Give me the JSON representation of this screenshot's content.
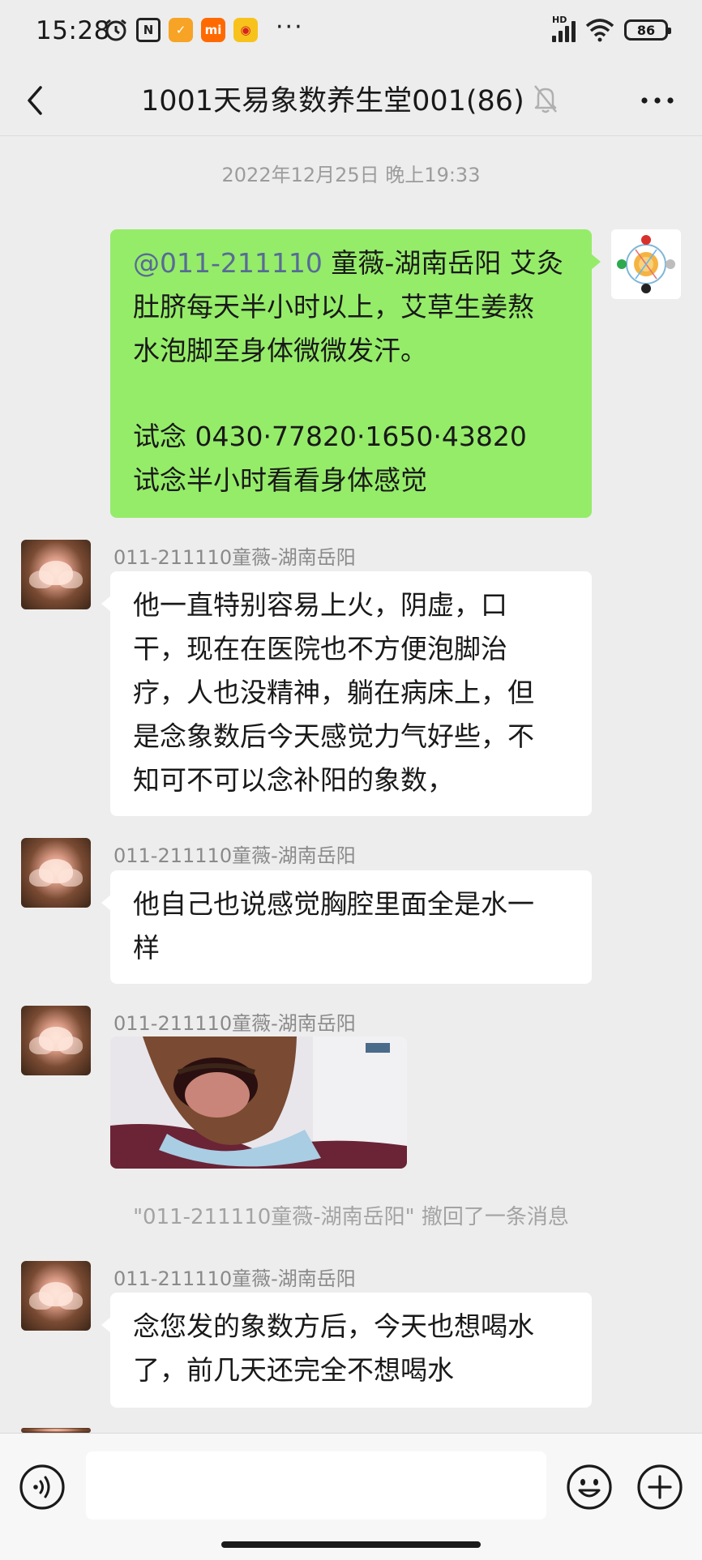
{
  "status_bar": {
    "time": "15:28",
    "network_label": "HD",
    "battery": "86",
    "overflow_dots": "···",
    "app_icons": [
      "alarm-icon",
      "nfc-icon",
      "taobao-icon",
      "mi-icon",
      "weibo-icon"
    ]
  },
  "nav": {
    "title": "1001天易象数养生堂001(86)",
    "back_icon": "chevron-left-icon",
    "mute_icon": "bell-off-icon",
    "more_icon": "more-dots-icon"
  },
  "chat": {
    "timestamp": "2022年12月25日 晚上19:33",
    "self_message": {
      "mention": "@011-211110",
      "line1_rest": " 童薇-湖南岳阳  艾灸",
      "line2": "肚脐每天半小时以上，艾草生姜熬",
      "line3": "水泡脚至身体微微发汗。",
      "line4": "试念 0430·77820·1650·43820",
      "line5": "试念半小时看看身体感觉"
    },
    "messages": [
      {
        "sender": "011-211110童薇-湖南岳阳",
        "lines": [
          "他一直特别容易上火，阴虚，口",
          "干，现在在医院也不方便泡脚治",
          "疗，人也没精神，躺在病床上，但",
          "是念象数后今天感觉力气好些，不",
          "知可不可以念补阳的象数，"
        ]
      },
      {
        "sender": "011-211110童薇-湖南岳阳",
        "lines": [
          "他自己也说感觉胸腔里面全是水一",
          "样"
        ]
      },
      {
        "sender": "011-211110童薇-湖南岳阳",
        "type": "image"
      },
      {
        "sender": "011-211110童薇-湖南岳阳",
        "lines": [
          "念您发的象数方后，今天也想喝水",
          "了，前几天还完全不想喝水"
        ]
      }
    ],
    "recall_notice": "\"011-211110童薇-湖南岳阳\" 撤回了一条消息"
  },
  "input_bar": {
    "placeholder": "",
    "voice_icon": "voice-icon",
    "emoji_icon": "emoji-icon",
    "plus_icon": "plus-circle-icon"
  },
  "colors": {
    "background": "#ededed",
    "self_bubble": "#95ec69",
    "other_bubble": "#ffffff",
    "mention": "#576b95",
    "meta_text": "#9c9c9c"
  }
}
